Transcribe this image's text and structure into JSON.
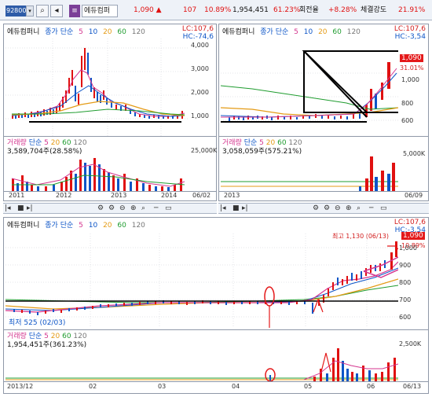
{
  "toolbar": {
    "stock_code": "92800",
    "stock_name": "에듀컴퍼",
    "price": "1,090",
    "price_arrow": "▲",
    "change": "107",
    "change_pct": "10.89%",
    "volume": "1,954,451",
    "turnover_pct": "61.23%",
    "turnover_label": "회전율",
    "strength_change": "+8.28%",
    "strength_label": "체결강도",
    "strength_value": "21.91%"
  },
  "top_left": {
    "title": "에듀컴퍼니",
    "series_label": "종가 단순",
    "ma": [
      "5",
      "10",
      "20",
      "60",
      "120"
    ],
    "lc": "LC:107,6",
    "hc": "HC:-74,6",
    "y_ticks": [
      "4,000",
      "3,000",
      "2,000",
      "1,000"
    ],
    "volume_title": "거래량",
    "volume_series": "단순",
    "volume_ma": [
      "5",
      "20",
      "60",
      "120"
    ],
    "volume_value": "3,589,704주(28.58%)",
    "volume_ticks": [
      "25,000K"
    ],
    "x_labels": [
      "2011",
      "2012",
      "2013",
      "2014",
      "06/02"
    ]
  },
  "top_right": {
    "title": "에듀컴퍼니",
    "series_label": "종가 단순",
    "ma": [
      "5",
      "10",
      "20",
      "60",
      "120"
    ],
    "lc": "LC:107,6",
    "hc": "HC:-3,54",
    "price_tag": "1,090",
    "price_tag2": "31.01%",
    "y_ticks": [
      "1,000",
      "800",
      "600"
    ],
    "volume_title": "거래량",
    "volume_series": "단순",
    "volume_ma": [
      "5",
      "20",
      "60",
      "120"
    ],
    "volume_value": "3,058,059주(575.21%)",
    "volume_ticks": [
      "5,000K"
    ],
    "x_labels": [
      "2013",
      "06/09"
    ]
  },
  "bottom": {
    "title": "에듀컴퍼니",
    "series_label": "종가 단순",
    "ma": [
      "5",
      "10",
      "20",
      "60",
      "120"
    ],
    "lc": "LC:107,6",
    "hc": "HC:-3,54",
    "price_tag": "1,090",
    "price_tag2": "10.89%",
    "high_label": "최고 1,130 (06/13)",
    "low_label": "최저 525 (02/03)",
    "y_ticks": [
      "1,000",
      "900",
      "800",
      "700",
      "600"
    ],
    "volume_title": "거래량",
    "volume_series": "단순",
    "volume_ma": [
      "5",
      "20",
      "60",
      "120"
    ],
    "volume_value": "1,954,451주(361.23%)",
    "volume_ticks": [
      "2,500K"
    ],
    "x_labels": [
      "2013/12",
      "02",
      "03",
      "04",
      "05",
      "06",
      "06/13"
    ]
  },
  "colors": {
    "up": "#e01010",
    "down": "#0d55c7",
    "ma5": "#d4368f",
    "ma20": "#e49b16",
    "ma60": "#1f9c2f",
    "ma120": "#888888",
    "annotation": "#e4191a"
  }
}
